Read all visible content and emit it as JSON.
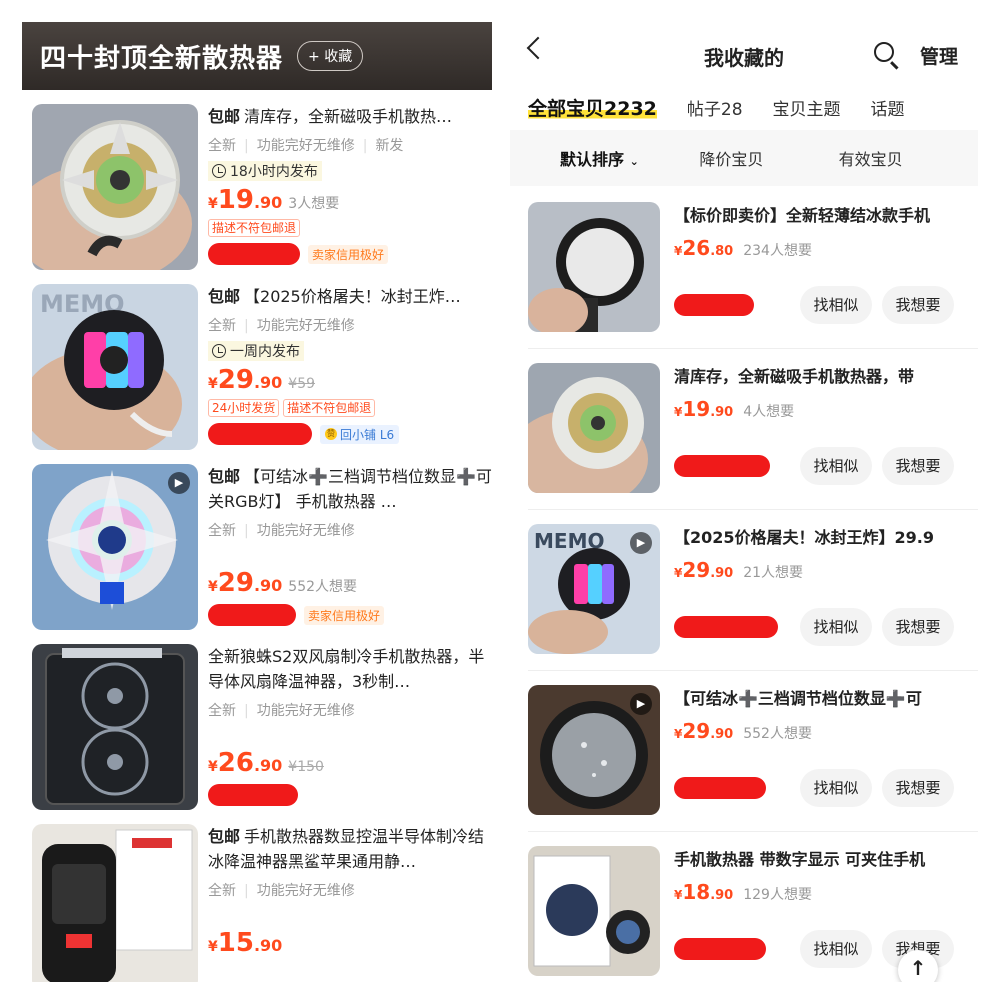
{
  "left": {
    "title": "四十封顶全新散热器",
    "fav_label": "+ 收藏",
    "items": [
      {
        "baoyou": "包邮",
        "title": "清库存，全新磁吸手机散热…",
        "tags": [
          "全新",
          "功能完好无维修",
          "新发"
        ],
        "time_badge": "18小时内发布",
        "price_int": "19",
        "price_dec": ".90",
        "price_sym": "¥",
        "want": "3人想要",
        "orig": "",
        "badges": [
          "描述不符包邮退"
        ],
        "credit": "卖家信用极好",
        "fish_badge": ""
      },
      {
        "baoyou": "包邮",
        "title": "【2025价格屠夫！冰封王炸…",
        "tags": [
          "全新",
          "功能完好无维修"
        ],
        "time_badge": "一周内发布",
        "price_int": "29",
        "price_dec": ".90",
        "price_sym": "¥",
        "want": "",
        "orig": "¥59",
        "badges": [
          "24小时发货",
          "描述不符包邮退"
        ],
        "credit": "",
        "fish_badge": "回小铺 L6",
        "fish_badge_icon": "赞"
      },
      {
        "baoyou": "包邮",
        "title": "【可结冰➕三档调节档位数显➕可关RGB灯】 手机散热器 …",
        "tags": [
          "全新",
          "功能完好无维修"
        ],
        "time_badge": "",
        "price_int": "29",
        "price_dec": ".90",
        "price_sym": "¥",
        "want": "552人想要",
        "orig": "",
        "badges": [],
        "credit": "卖家信用极好",
        "fish_badge": ""
      },
      {
        "baoyou": "",
        "title": "全新狼蛛S2双风扇制冷手机散热器，半导体风扇降温神器，3秒制…",
        "tags": [
          "全新",
          "功能完好无维修"
        ],
        "time_badge": "",
        "price_int": "26",
        "price_dec": ".90",
        "price_sym": "¥",
        "want": "",
        "orig": "¥150",
        "badges": [],
        "credit": "",
        "fish_badge": ""
      },
      {
        "baoyou": "包邮",
        "title": "手机散热器数显控温半导体制冷结冰降温神器黑鲨苹果通用静…",
        "tags": [
          "全新",
          "功能完好无维修"
        ],
        "time_badge": "",
        "price_int": "15",
        "price_dec": ".90",
        "price_sym": "¥",
        "want": "",
        "orig": "",
        "badges": [],
        "credit": "",
        "fish_badge": ""
      }
    ]
  },
  "right": {
    "title": "我收藏的",
    "manage": "管理",
    "tabs": [
      "全部宝贝2232",
      "帖子28",
      "宝贝主题",
      "话题"
    ],
    "sorts": [
      "默认排序",
      "降价宝贝",
      "有效宝贝"
    ],
    "similar_label": "找相似",
    "want_label": "我想要",
    "scroll_top": "↑",
    "items": [
      {
        "title": "【标价即卖价】全新轻薄结冰款手机",
        "price_sym": "¥",
        "price_int": "26",
        "price_dec": ".80",
        "want": "234人想要"
      },
      {
        "title": "清库存，全新磁吸手机散热器，带",
        "price_sym": "¥",
        "price_int": "19",
        "price_dec": ".90",
        "want": "4人想要"
      },
      {
        "title": "【2025价格屠夫！冰封王炸】29.9",
        "price_sym": "¥",
        "price_int": "29",
        "price_dec": ".90",
        "want": "21人想要"
      },
      {
        "title": "【可结冰➕三档调节档位数显➕可",
        "price_sym": "¥",
        "price_int": "29",
        "price_dec": ".90",
        "want": "552人想要"
      },
      {
        "title": "手机散热器 带数字显示 可夹住手机",
        "price_sym": "¥",
        "price_int": "18",
        "price_dec": ".90",
        "want": "129人想要"
      }
    ]
  },
  "thumb_text": {
    "memo": "MEMO"
  },
  "colors": {
    "price": "#ff4a1d",
    "redaction": "#f01a1a",
    "header_bg": "#3a3431",
    "active_tab_highlight": "#ffe23a"
  }
}
